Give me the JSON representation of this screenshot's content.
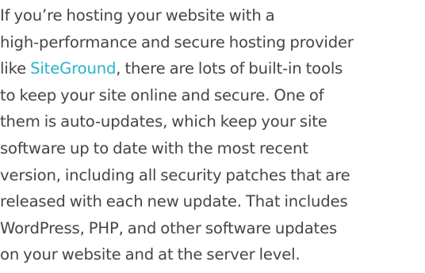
{
  "article": {
    "paragraph": {
      "line_1": "If you’re hosting your website with a",
      "line_2": "high-performance and secure hosting provider",
      "line_3_before_link": "like ",
      "link_text": "SiteGround",
      "line_3_after_link": ", there are lots of built-in tools",
      "line_4": "to keep your site online and secure. One of",
      "line_5": "them is auto-updates, which keep your site",
      "line_6": "software up to date with the most recent",
      "line_7": "version, including all security patches that are",
      "line_8": "released with each new update. That includes",
      "line_9": "WordPress, PHP, and other software updates",
      "line_10": "on your website and at the server level."
    }
  },
  "colors": {
    "body_text": "#454545",
    "link": "#27b3c9",
    "background": "#ffffff"
  }
}
